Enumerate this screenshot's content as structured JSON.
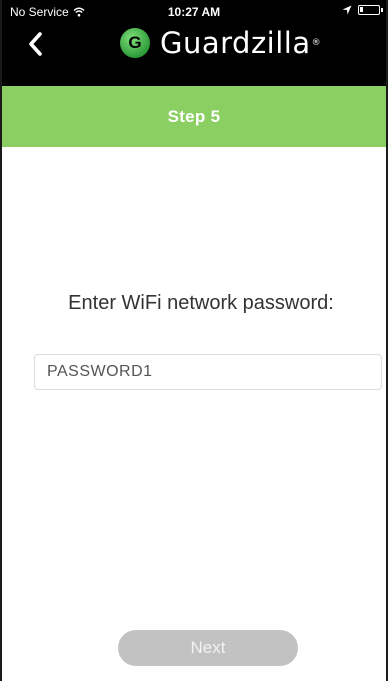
{
  "status_bar": {
    "carrier": "No Service",
    "time": "10:27 AM"
  },
  "nav": {
    "logo_letter": "G",
    "brand_name": "Guardzilla",
    "brand_mark": "®"
  },
  "step": {
    "title": "Step 5"
  },
  "content": {
    "prompt": "Enter WiFi network password:",
    "password_value": "PASSWORD1",
    "next_label": "Next"
  },
  "icons": {
    "back": "chevron-left-icon",
    "wifi": "wifi-icon",
    "location": "location-arrow-icon",
    "battery": "battery-icon"
  },
  "colors": {
    "header_bg": "#000000",
    "step_bar": "#8bcf63",
    "logo_green": "#2e9b3a",
    "next_button_disabled": "#c2c2c2"
  }
}
